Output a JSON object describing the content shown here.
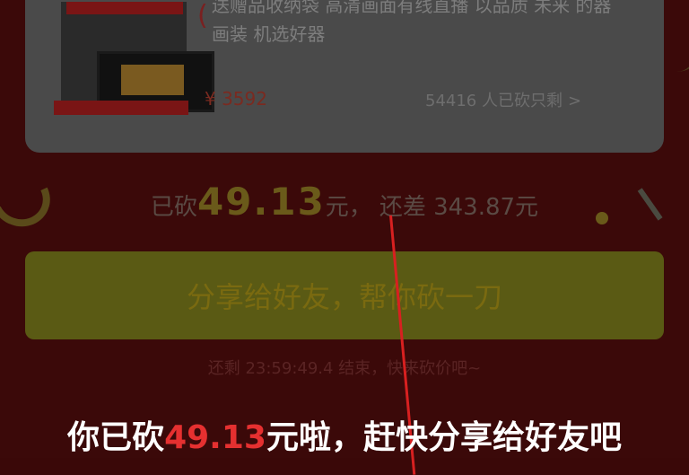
{
  "product": {
    "description": "送赠品收纳袋 高清画面有线直播 以品质 未来 的器画装 机选好器",
    "price_label": "¥ 3592",
    "sold_text": "54416 人已砍只剩",
    "chevron": ">"
  },
  "progress": {
    "prefix": "已砍",
    "amount": "49.13",
    "unit": "元，",
    "remaining_text": "还差 343.87元"
  },
  "share_button": {
    "label": "分享给好友，帮你砍一刀"
  },
  "remaining": {
    "text": "还剩 23:59:49.4 结束，快来砍价吧~"
  },
  "caption": {
    "prefix": "你已砍",
    "amount": "49.13",
    "suffix": "元啦，赶快分享给好友吧"
  },
  "colors": {
    "background": "#3b0909",
    "pointer": "#d82020",
    "caption_amount": "#e53030"
  },
  "icons": [
    "chevron-right-icon",
    "ornament-icon"
  ]
}
